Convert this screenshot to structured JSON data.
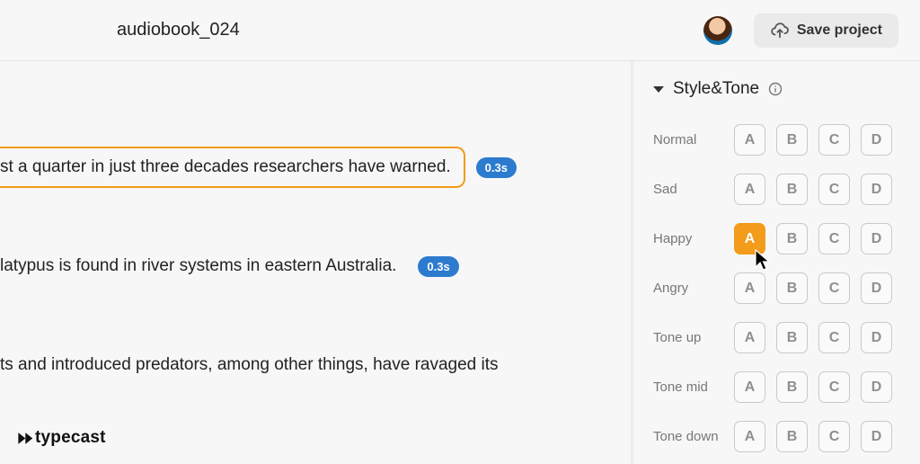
{
  "header": {
    "title": "audiobook_024",
    "save_label": "Save project"
  },
  "editor": {
    "lines": [
      {
        "text": "st a quarter in just three decades researchers have warned.",
        "duration": "0.3s",
        "selected": true,
        "has_chip": true
      },
      {
        "text": "latypus is found in river systems in eastern Australia.",
        "duration": "0.3s",
        "selected": false,
        "has_chip": true
      },
      {
        "text": "ts and introduced predators, among other things, have ravaged its",
        "duration": "",
        "selected": false,
        "has_chip": false
      }
    ],
    "brand": "typecast"
  },
  "panel": {
    "section_title": "Style&Tone",
    "option_letters": [
      "A",
      "B",
      "C",
      "D"
    ],
    "rows": [
      {
        "label": "Normal",
        "selected": null
      },
      {
        "label": "Sad",
        "selected": null
      },
      {
        "label": "Happy",
        "selected": "A"
      },
      {
        "label": "Angry",
        "selected": null
      },
      {
        "label": "Tone up",
        "selected": null
      },
      {
        "label": "Tone mid",
        "selected": null
      },
      {
        "label": "Tone down",
        "selected": null
      }
    ]
  }
}
